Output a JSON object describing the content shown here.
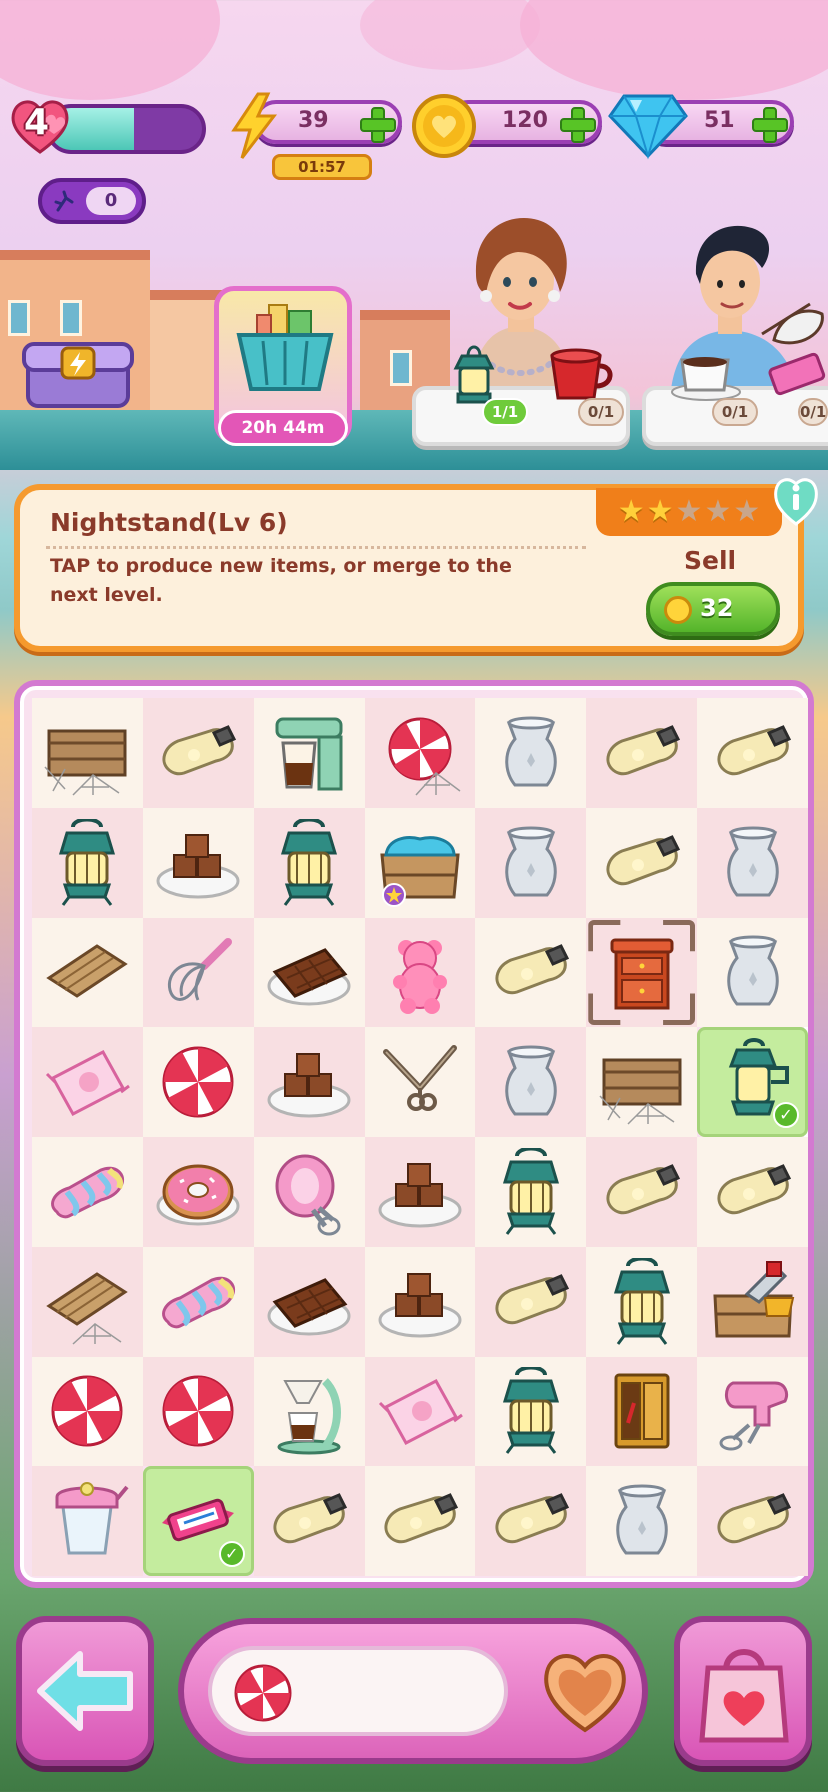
{
  "hud": {
    "lives": "4",
    "lives_fill_fraction": 0.55,
    "energy": "39",
    "energy_timer": "01:57",
    "coins": "120",
    "gems": "51",
    "stat_small": "0"
  },
  "shop": {
    "timer": "20h 44m"
  },
  "orders": [
    {
      "badges": [
        "1/1",
        "0/1"
      ]
    },
    {
      "badges": [
        "0/1",
        "0/1"
      ]
    }
  ],
  "info": {
    "title": "Nightstand(Lv 6)",
    "description": "TAP to produce new items, or merge to the next level.",
    "stars_filled": 2,
    "stars_total": 5,
    "sell_label": "Sell",
    "sell_price": "32"
  },
  "board": {
    "rows": [
      [
        "crate-cobweb",
        "bulb",
        "coffee-maker",
        "candy-swirl-cobweb",
        "vase",
        "bulb",
        "bulb"
      ],
      [
        "lantern",
        "choco-cubes",
        "lantern",
        "crate-blue",
        "vase",
        "bulb",
        "vase"
      ],
      [
        "planks",
        "whisk",
        "choco-bar",
        "gummy-bear",
        "bulb",
        "nightstand",
        "vase"
      ],
      [
        "candy-pack",
        "candy-swirl",
        "choco-cubes",
        "scissors",
        "vase",
        "crate-cobweb",
        "lantern-green"
      ],
      [
        "marshmallow",
        "donut",
        "mixer",
        "choco-cubes",
        "lantern",
        "bulb",
        "bulb"
      ],
      [
        "planks-cobweb",
        "marshmallow",
        "choco-bar",
        "choco-cubes",
        "bulb",
        "lantern",
        "crate-saw"
      ],
      [
        "candy-swirl",
        "candy-swirl",
        "coffee-filter",
        "candy-pack",
        "lantern",
        "cabinet",
        "mixer-pink"
      ],
      [
        "blender",
        "candy-bar",
        "bulb",
        "bulb",
        "bulb",
        "vase",
        "bulb"
      ]
    ],
    "selected_cell": [
      2,
      5
    ],
    "done_cells": [
      [
        3,
        6
      ],
      [
        7,
        1
      ]
    ]
  },
  "bottom": {
    "left_button_icon": "arrow-left-icon",
    "tray_item_icon": "candy-swirl-icon",
    "tray_heart_icon": "heart-tray-icon",
    "shop_icon": "shopping-bag-icon"
  }
}
